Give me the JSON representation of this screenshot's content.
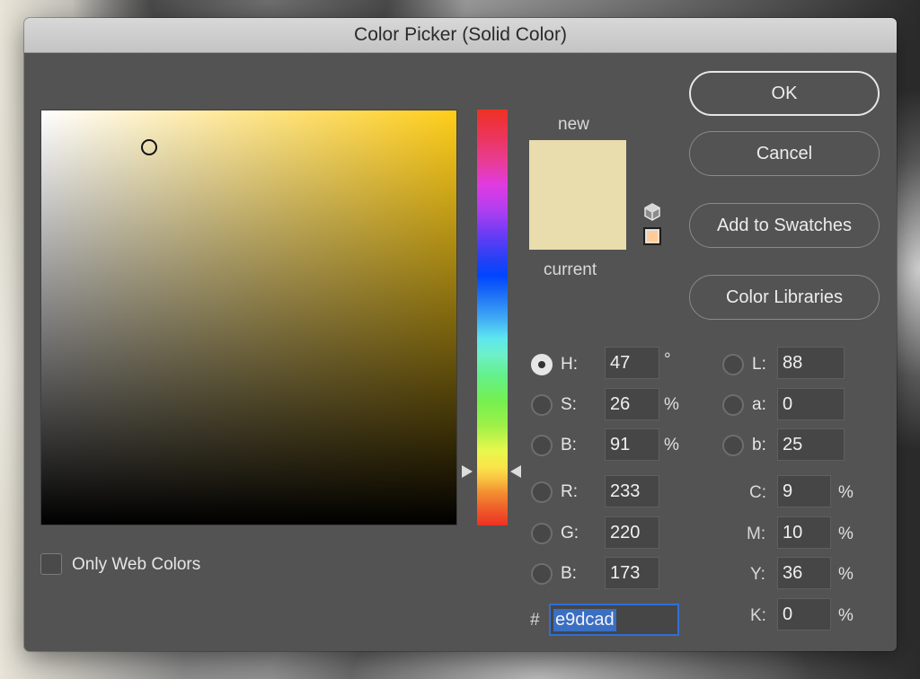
{
  "window": {
    "title": "Color Picker (Solid Color)"
  },
  "picker": {
    "new_label": "new",
    "current_label": "current",
    "new_color": "#e9dcad",
    "current_color": "#e9dcad",
    "web_safe_color": "#ffcc99",
    "hue_degrees": 47,
    "marker_saturation_pct": 26,
    "marker_brightness_pct": 91
  },
  "buttons": {
    "ok": "OK",
    "cancel": "Cancel",
    "add_to_swatches": "Add to Swatches",
    "color_libraries": "Color Libraries"
  },
  "hsb": [
    {
      "label": "H:",
      "value": "47",
      "unit": "°",
      "selected": true
    },
    {
      "label": "S:",
      "value": "26",
      "unit": "%",
      "selected": false
    },
    {
      "label": "B:",
      "value": "91",
      "unit": "%",
      "selected": false
    }
  ],
  "rgb": [
    {
      "label": "R:",
      "value": "233",
      "selected": false
    },
    {
      "label": "G:",
      "value": "220",
      "selected": false
    },
    {
      "label": "B:",
      "value": "173",
      "selected": false
    }
  ],
  "lab": [
    {
      "label": "L:",
      "value": "88",
      "selected": false
    },
    {
      "label": "a:",
      "value": "0",
      "selected": false
    },
    {
      "label": "b:",
      "value": "25",
      "selected": false
    }
  ],
  "cmyk": [
    {
      "label": "C:",
      "value": "9",
      "unit": "%"
    },
    {
      "label": "M:",
      "value": "10",
      "unit": "%"
    },
    {
      "label": "Y:",
      "value": "36",
      "unit": "%"
    },
    {
      "label": "K:",
      "value": "0",
      "unit": "%"
    }
  ],
  "hex": {
    "prefix": "#",
    "value": "e9dcad"
  },
  "only_web_colors": {
    "label": "Only Web Colors",
    "checked": false
  }
}
